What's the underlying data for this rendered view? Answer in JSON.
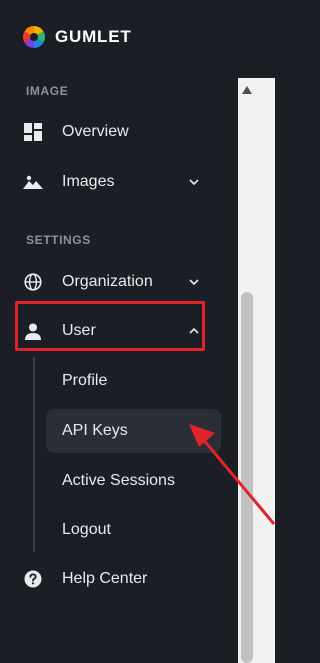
{
  "brand": {
    "name": "GUMLET"
  },
  "sections": {
    "image_title": "IMAGE",
    "settings_title": "SETTINGS"
  },
  "nav": {
    "overview": "Overview",
    "images": "Images",
    "organization": "Organization",
    "user": "User",
    "help_center": "Help Center"
  },
  "user_submenu": {
    "profile": "Profile",
    "api_keys": "API Keys",
    "active_sessions": "Active Sessions",
    "logout": "Logout"
  },
  "icons": {
    "overview": "dashboard-grid-icon",
    "images": "image-mountain-icon",
    "organization": "globe-icon",
    "user": "person-icon",
    "help_center": "question-circle-icon"
  },
  "colors": {
    "sidebar_bg": "#1b1e25",
    "text": "#e8eaee",
    "section_title": "#8b929e",
    "active_bg": "#2a2e36",
    "annotation_red": "#e3232b"
  }
}
